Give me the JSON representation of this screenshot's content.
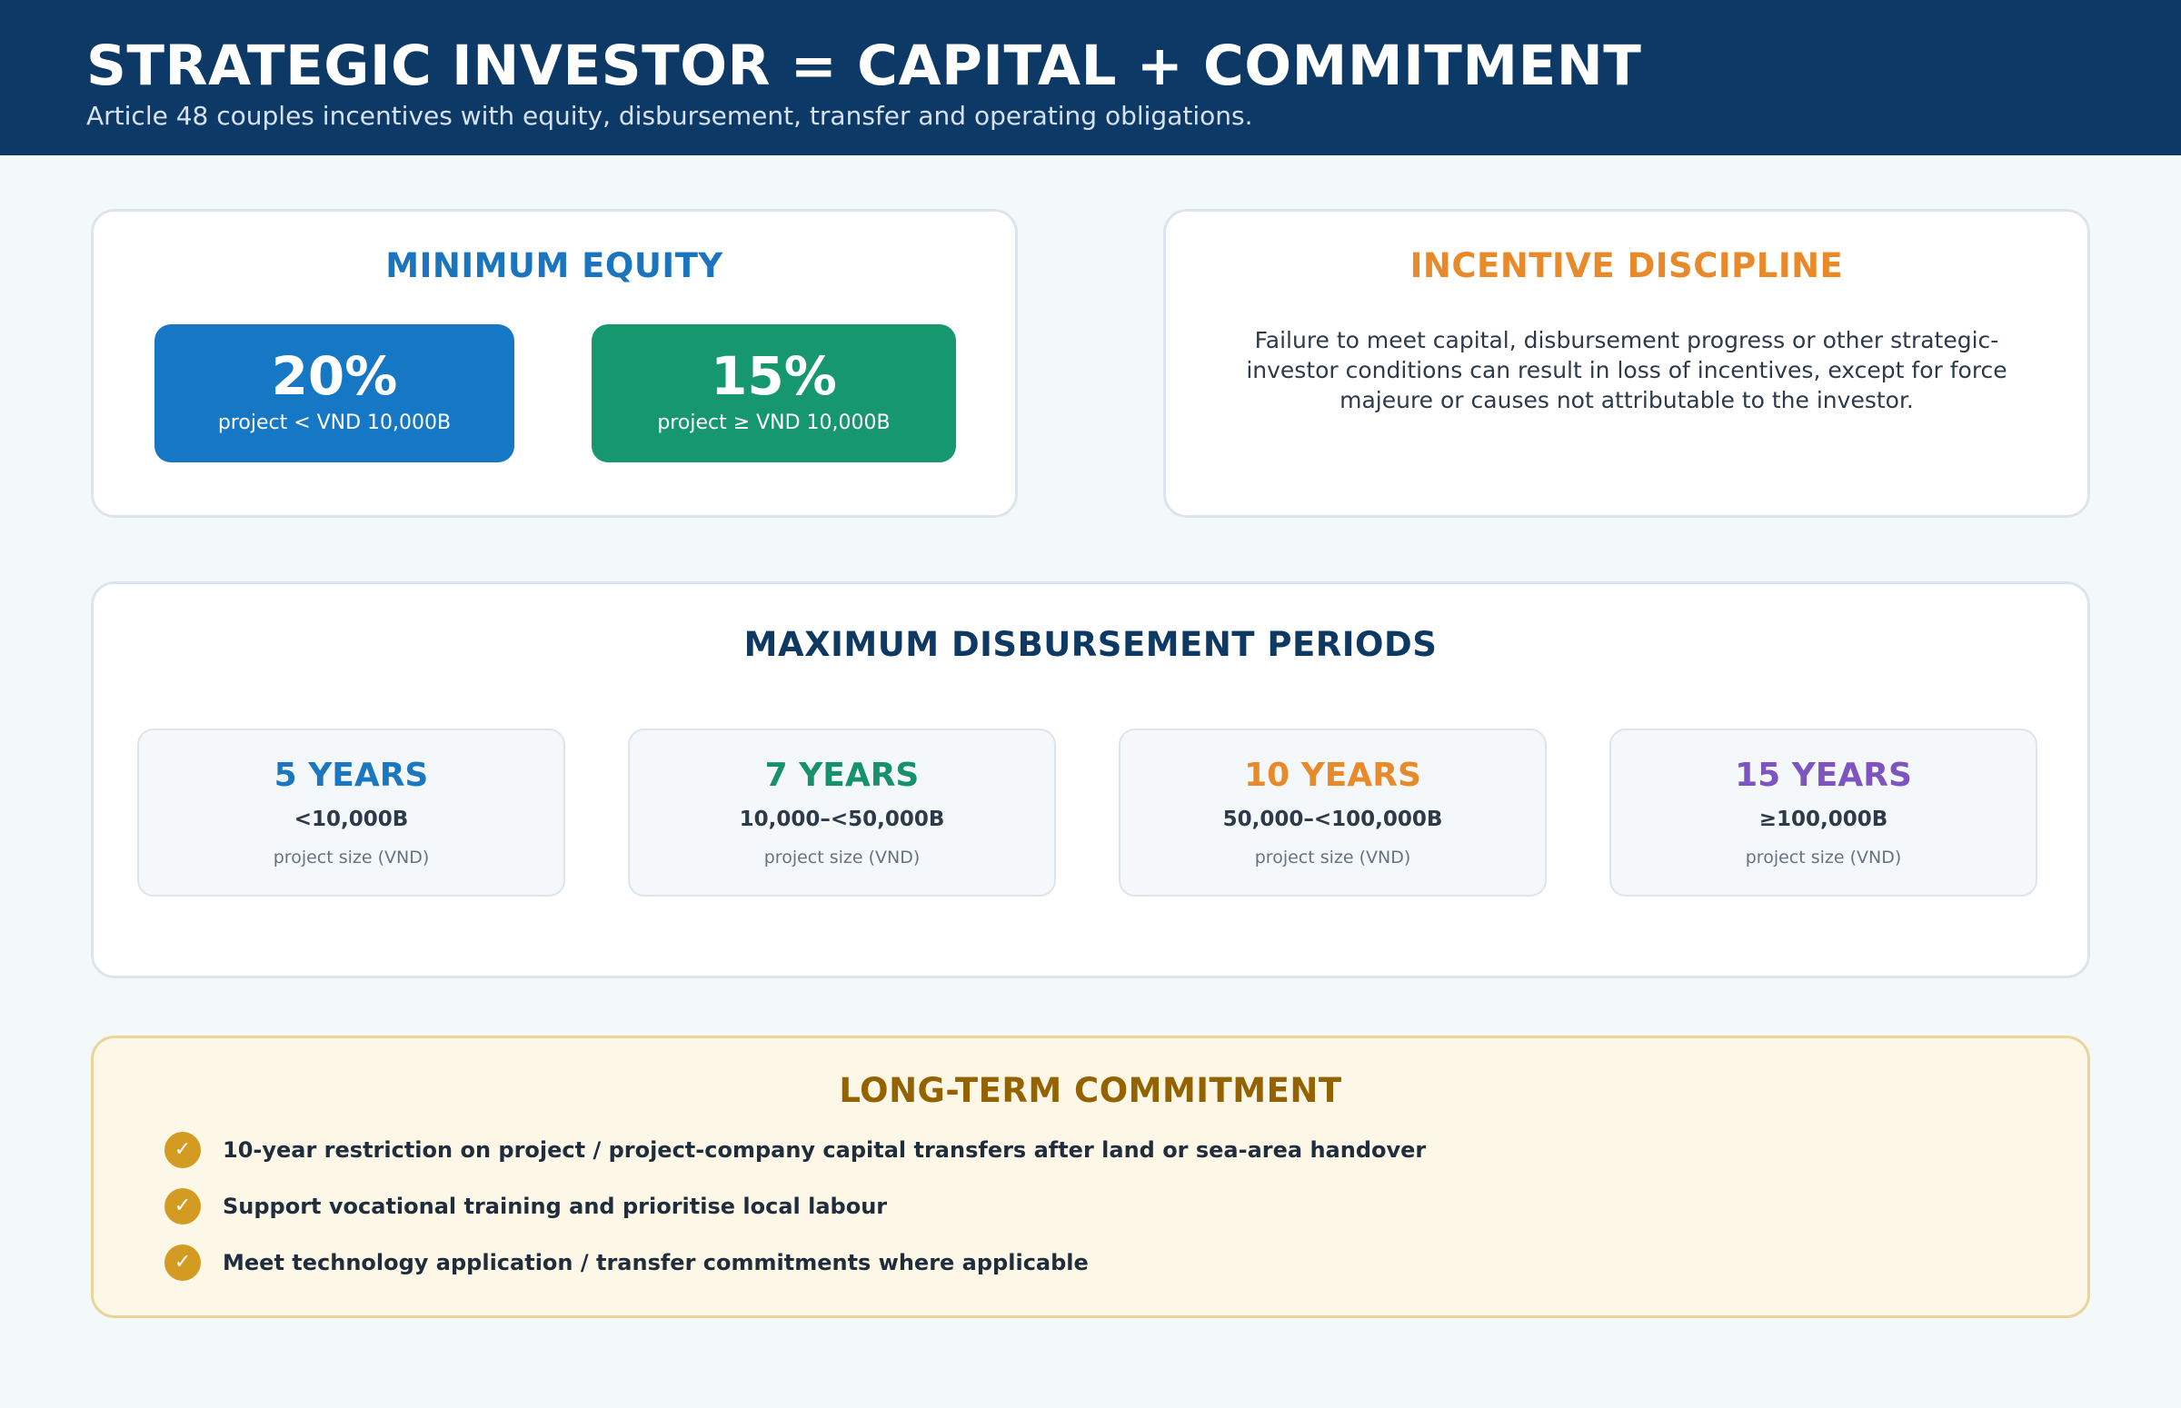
{
  "header": {
    "title": "STRATEGIC INVESTOR = CAPITAL + COMMITMENT",
    "subtitle": "Article 48 couples incentives with equity, disbursement, transfer and operating obligations."
  },
  "minimum_equity": {
    "title": "MINIMUM EQUITY",
    "tiles": [
      {
        "value": "20%",
        "label": "project < VND 10,000B",
        "color": "#1677c4"
      },
      {
        "value": "15%",
        "label": "project ≥ VND 10,000B",
        "color": "#16976e"
      }
    ]
  },
  "incentive_discipline": {
    "title": "INCENTIVE DISCIPLINE",
    "body": "Failure to meet capital, disbursement progress or other strategic-investor conditions can result in loss of incentives, except for force majeure or causes not attributable to the investor."
  },
  "disbursement": {
    "title": "MAXIMUM DISBURSEMENT PERIODS",
    "periods": [
      {
        "years": "5 YEARS",
        "size": "<10,000B",
        "unit": "project size (VND)",
        "color": "#1b78c0"
      },
      {
        "years": "7 YEARS",
        "size": "10,000–<50,000B",
        "unit": "project size (VND)",
        "color": "#17916b"
      },
      {
        "years": "10 YEARS",
        "size": "50,000–<100,000B",
        "unit": "project size (VND)",
        "color": "#e88a2a"
      },
      {
        "years": "15 YEARS",
        "size": "≥100,000B",
        "unit": "project size (VND)",
        "color": "#7e55c0"
      }
    ]
  },
  "commitment": {
    "title": "LONG-TERM COMMITMENT",
    "items": [
      "10-year restriction on project / project-company capital transfers after land or sea-area handover",
      "Support vocational training and prioritise local labour",
      "Meet technology application / transfer commitments where applicable"
    ],
    "check_icon": "✓"
  },
  "colors": {
    "header_bg": "#0c3966",
    "equity_title": "#1a75be",
    "incentive_title": "#e88a2a",
    "disbursement_title": "#0d3963",
    "commitment_title": "#946300"
  }
}
